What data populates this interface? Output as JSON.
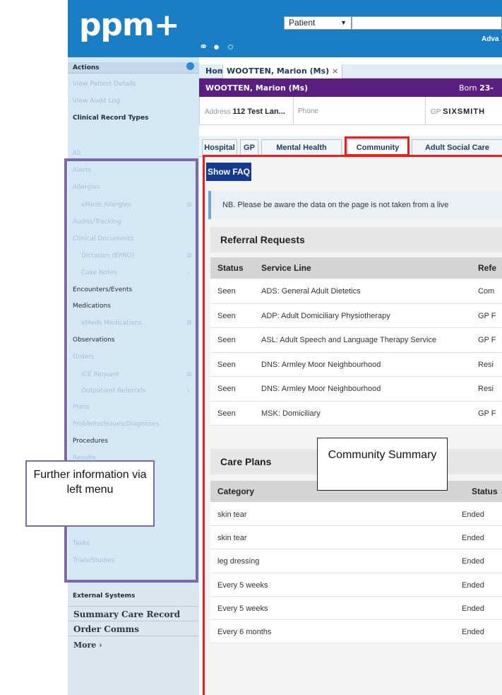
{
  "header": {
    "logo": "ppm+",
    "patient_select": "Patient",
    "advanced_link": "Adva",
    "icons": [
      "link-icon",
      "person-icon",
      "circle-icon"
    ]
  },
  "sidebar": {
    "actions_title": "Actions",
    "view_patient_details": "View Patient Details",
    "view_audit_log": "View Audit Log",
    "clinical_record_types": "Clinical Record Types",
    "items": [
      {
        "label": "All",
        "style": "muted",
        "indent": false
      },
      {
        "label": "Alerts",
        "style": "muted",
        "indent": false
      },
      {
        "label": "Allergies",
        "style": "muted",
        "indent": false
      },
      {
        "label": "eMeds Allergies",
        "style": "muted",
        "indent": true,
        "icon": "external-link-icon"
      },
      {
        "label": "Audits/Tracking",
        "style": "muted",
        "indent": false
      },
      {
        "label": "Clinical Documents",
        "style": "muted",
        "indent": false
      },
      {
        "label": "Dictation (EPRO)",
        "style": "muted",
        "indent": true,
        "icon": "external-link-icon"
      },
      {
        "label": "Case Notes",
        "style": "muted",
        "indent": true,
        "icon": "chevron-right-icon"
      },
      {
        "label": "Encounters/Events",
        "style": "dark",
        "indent": false
      },
      {
        "label": "Medications",
        "style": "dark",
        "indent": false
      },
      {
        "label": "eMeds Medications",
        "style": "muted",
        "indent": true,
        "icon": "external-link-icon"
      },
      {
        "label": "Observations",
        "style": "dark",
        "indent": false
      },
      {
        "label": "Orders",
        "style": "muted",
        "indent": false
      },
      {
        "label": "ICE Request",
        "style": "muted",
        "indent": true,
        "icon": "external-link-icon"
      },
      {
        "label": "Outpatient Referrals",
        "style": "muted",
        "indent": true,
        "icon": "chevron-right-icon"
      },
      {
        "label": "Plans",
        "style": "muted",
        "indent": false
      },
      {
        "label": "Problems/Issues/Diagnoses",
        "style": "muted",
        "indent": false
      },
      {
        "label": "Procedures",
        "style": "dark",
        "indent": false
      },
      {
        "label": "Results",
        "style": "muted",
        "indent": false
      },
      {
        "label": "Tasks",
        "style": "muted",
        "indent": false
      },
      {
        "label": "Trials/Studies",
        "style": "muted",
        "indent": false
      }
    ],
    "external_systems": "External Systems",
    "summary_care_record": "Summary Care Record",
    "order_comms": "Order Comms",
    "more": "More ›"
  },
  "tabs": {
    "home": "Home",
    "patient_tab": "WOOTTEN, Marion (Ms)",
    "close_glyph": "×"
  },
  "patient": {
    "name": "WOOTTEN, Marion (Ms)",
    "born_label": "Born",
    "born_value": "23-",
    "address_label": "Address",
    "address_value": "112 Test Lan...",
    "phone_label": "Phone",
    "gp_label": "GP",
    "gp_value": "SIXSMITH"
  },
  "care_tabs": [
    "Hospital",
    "GP",
    "Mental Health",
    "Community",
    "Adult Social Care"
  ],
  "active_care_tab": "Community",
  "main": {
    "faq_button": "Show FAQ",
    "notice": "NB. Please be aware the data on the page is not taken from a live",
    "referrals": {
      "title": "Referral Requests",
      "columns": [
        "Status",
        "Service Line",
        "Refe"
      ],
      "rows": [
        [
          "Seen",
          "ADS: General Adult Dietetics",
          "Com"
        ],
        [
          "Seen",
          "ADP: Adult Domiciliary Physiotherapy",
          "GP F"
        ],
        [
          "Seen",
          "ASL: Adult Speech and Language Therapy Service",
          "GP F"
        ],
        [
          "Seen",
          "DNS: Armley Moor Neighbourhood",
          "Resi"
        ],
        [
          "Seen",
          "DNS: Armley Moor Neighbourhood",
          "Resi"
        ],
        [
          "Seen",
          "MSK: Domiciliary",
          "GP F"
        ]
      ]
    },
    "care_plans": {
      "title": "Care Plans",
      "columns": [
        "Category",
        "Status"
      ],
      "rows": [
        [
          "skin tear",
          "Ended"
        ],
        [
          "skin tear",
          "Ended"
        ],
        [
          "leg dressing",
          "Ended"
        ],
        [
          "Every 5 weeks",
          "Ended"
        ],
        [
          "Every 5 weeks",
          "Ended"
        ],
        [
          "Every 6 months",
          "Ended"
        ]
      ]
    }
  },
  "annotations": {
    "left_callout": "Further information via left menu",
    "summary_callout": "Community Summary",
    "left_box_color": "#7b69a8",
    "community_box_color": "#ec1c1c"
  }
}
